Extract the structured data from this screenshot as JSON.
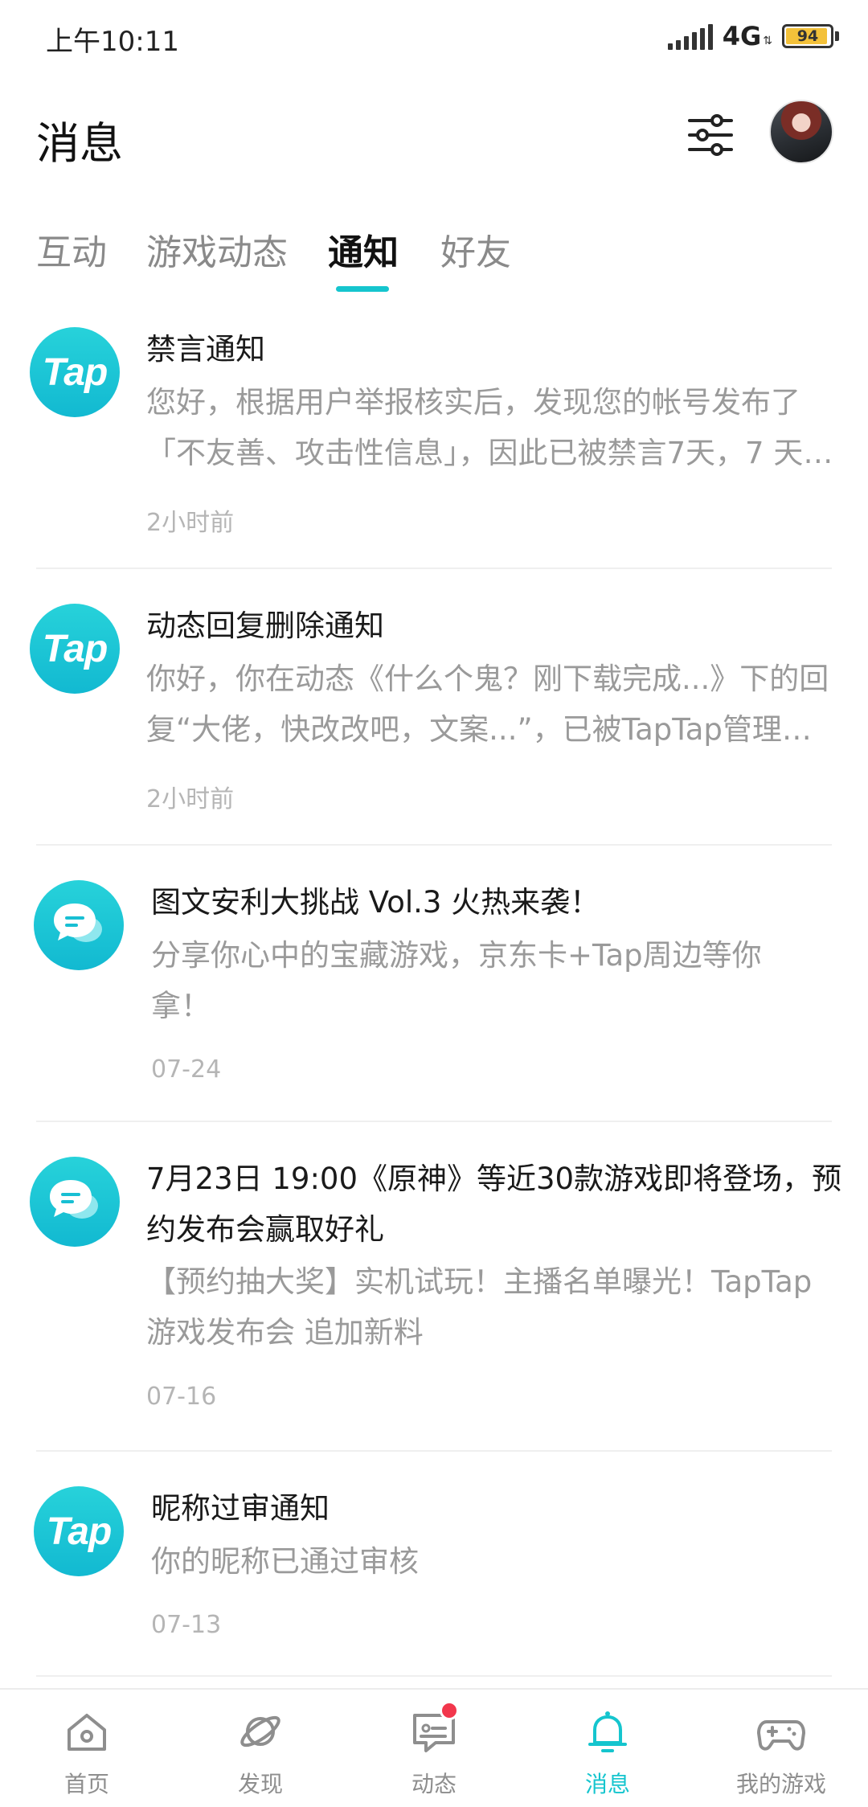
{
  "status_bar": {
    "time": "上午10:11",
    "network": "4G",
    "battery": "94",
    "battery_level": 0.94
  },
  "header": {
    "title": "消息"
  },
  "tabs": [
    {
      "label": "互动",
      "active": false
    },
    {
      "label": "游戏动态",
      "active": false
    },
    {
      "label": "通知",
      "active": true
    },
    {
      "label": "好友",
      "active": false
    }
  ],
  "notifications": [
    {
      "icon": "tap-logo-icon",
      "icon_text": "Tap",
      "title": "禁言通知",
      "body_line1": "您好，根据用户举报核实后，发现您的帐号发布了",
      "body_line2": "「不友善、攻击性信息」，因此已被禁言7天，7 天…",
      "time": "2小时前"
    },
    {
      "icon": "tap-logo-icon",
      "icon_text": "Tap",
      "title": "动态回复删除通知",
      "body_line1": "你好，你在动态《什么个鬼？刚下载完成...》下的回",
      "body_line2": "复“大佬，快改改吧，文案...”，已被TapTap管理…",
      "time": "2小时前"
    },
    {
      "icon": "chat-bubble-icon",
      "title": "图文安利大挑战 Vol.3 火热来袭！",
      "body_line1": "分享你心中的宝藏游戏，京东卡+Tap周边等你",
      "body_line2": "拿！",
      "time": "07-24"
    },
    {
      "icon": "chat-bubble-icon",
      "title_line1": "7月23日 19:00《原神》等近30款游戏即将登场，预",
      "title_line2": "约发布会赢取好礼",
      "body_line1": "【预约抽大奖】实机试玩！主播名单曝光！TapTap",
      "body_line2": "游戏发布会 追加新料",
      "time": "07-16"
    },
    {
      "icon": "tap-logo-icon",
      "icon_text": "Tap",
      "title": "昵称过审通知",
      "body_line1": "你的昵称已通过审核",
      "time": "07-13"
    }
  ],
  "bottom_nav": [
    {
      "label": "首页",
      "icon": "home-icon",
      "active": false
    },
    {
      "label": "发现",
      "icon": "planet-icon",
      "active": false
    },
    {
      "label": "动态",
      "icon": "moments-icon",
      "active": false,
      "badge": true
    },
    {
      "label": "消息",
      "icon": "bell-icon",
      "active": true
    },
    {
      "label": "我的游戏",
      "icon": "gamepad-icon",
      "active": false
    }
  ],
  "colors": {
    "accent": "#15c5ce",
    "badge": "#f2374c",
    "text_primary": "#1a1a1a",
    "text_secondary": "#9a9a9a"
  }
}
